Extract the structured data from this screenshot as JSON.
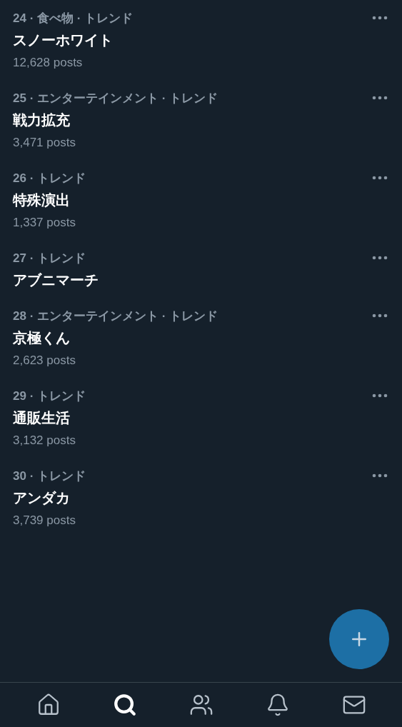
{
  "trends": [
    {
      "meta": "24 · 食べ物 · トレンド",
      "title": "スノーホワイト",
      "posts": "12,628 posts"
    },
    {
      "meta": "25 · エンターテインメント · トレンド",
      "title": "戦力拡充",
      "posts": "3,471 posts"
    },
    {
      "meta": "26 · トレンド",
      "title": "特殊演出",
      "posts": "1,337 posts"
    },
    {
      "meta": "27 · トレンド",
      "title": "アブニマーチ"
    },
    {
      "meta": "28 · エンターテインメント · トレンド",
      "title": "京極くん",
      "posts": "2,623 posts"
    },
    {
      "meta": "29 · トレンド",
      "title": "通販生活",
      "posts": "3,132 posts"
    },
    {
      "meta": "30 · トレンド",
      "title": "アンダカ",
      "posts": "3,739 posts"
    }
  ],
  "nav": [
    {
      "kind": "home",
      "selected": false
    },
    {
      "kind": "search",
      "selected": true
    },
    {
      "kind": "communities",
      "selected": false
    },
    {
      "kind": "notifications",
      "selected": false
    },
    {
      "kind": "messages",
      "selected": false
    }
  ]
}
